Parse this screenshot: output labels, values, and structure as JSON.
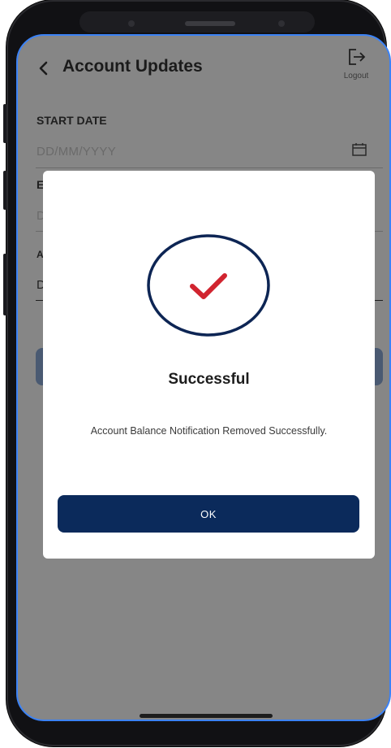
{
  "header": {
    "title": "Account Updates",
    "logout_label": "Logout"
  },
  "form": {
    "start_date_label": "START DATE",
    "start_date_placeholder": "DD/MM/YYYY",
    "end_date_label_partial": "E",
    "end_date_placeholder_partial": "D",
    "amount_label_partial": "A",
    "amount_value_partial": "D"
  },
  "dialog": {
    "title": "Successful",
    "message": "Account Balance Notification Removed Successfully.",
    "ok_label": "OK"
  },
  "colors": {
    "overlay_bg": "#868686",
    "primary_navy": "#0b2a5b",
    "check_red": "#d1242f",
    "modal_bg": "#ffffff"
  }
}
